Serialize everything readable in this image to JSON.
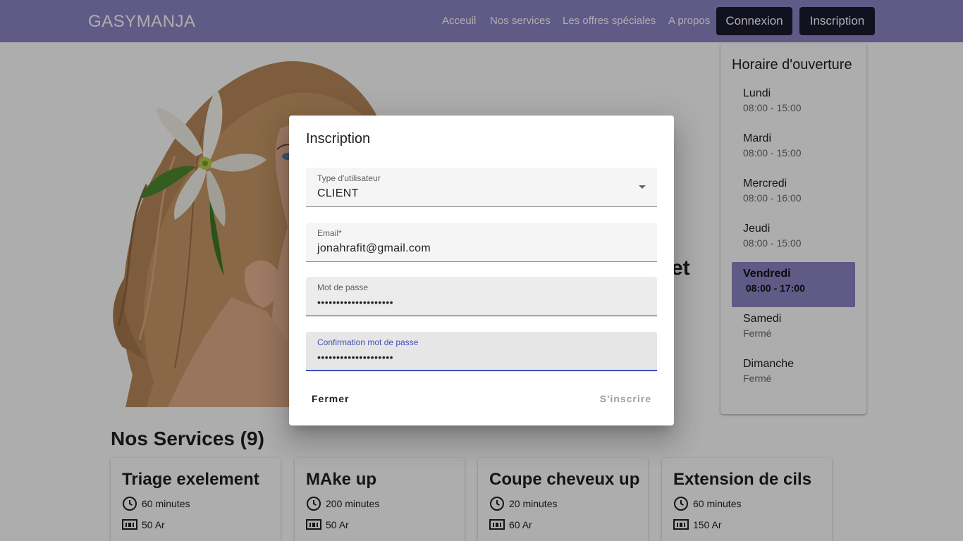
{
  "navbar": {
    "brand": "GASYMANJA",
    "links": [
      "Acceuil",
      "Nos services",
      "Les offres spéciales",
      "A propos"
    ],
    "login_label": "Connexion",
    "signup_label": "Inscription",
    "color": "#8e85c8"
  },
  "hero": {
    "partial_heading": "et"
  },
  "schedule": {
    "title": "Horaire d'ouverture",
    "days": [
      {
        "name": "Lundi",
        "hours": "08:00 - 15:00"
      },
      {
        "name": "Mardi",
        "hours": "08:00 - 15:00"
      },
      {
        "name": "Mercredi",
        "hours": "08:00 - 16:00"
      },
      {
        "name": "Jeudi",
        "hours": "08:00 - 15:00"
      },
      {
        "name": "Vendredi",
        "hours": " 08:00 - 17:00",
        "active": true
      },
      {
        "name": "Samedi",
        "hours": "Fermé"
      },
      {
        "name": "Dimanche",
        "hours": "Fermé"
      }
    ]
  },
  "services": {
    "title": "Nos Services (9)",
    "items": [
      {
        "name": "Triage exelement",
        "duration": "60 minutes",
        "price": "50 Ar"
      },
      {
        "name": "MAke up",
        "duration": "200 minutes",
        "price": "50 Ar"
      },
      {
        "name": "Coupe cheveux up",
        "duration": "20 minutes",
        "price": "60 Ar"
      },
      {
        "name": "Extension de cils",
        "duration": "60 minutes",
        "price": "150 Ar"
      }
    ]
  },
  "dialog": {
    "title": "Inscription",
    "user_type": {
      "label": "Type d'utilisateur",
      "value": "CLIENT"
    },
    "email": {
      "label": "Email*",
      "value": "jonahrafit@gmail.com"
    },
    "password": {
      "label": "Mot de passe",
      "value": "••••••••••••••••••••"
    },
    "confirm": {
      "label": "Confirmation mot de passe",
      "value": "••••••••••••••••••••"
    },
    "close_label": "Fermer",
    "submit_label": "S'inscrire",
    "accent_color": "#3f51b5"
  }
}
